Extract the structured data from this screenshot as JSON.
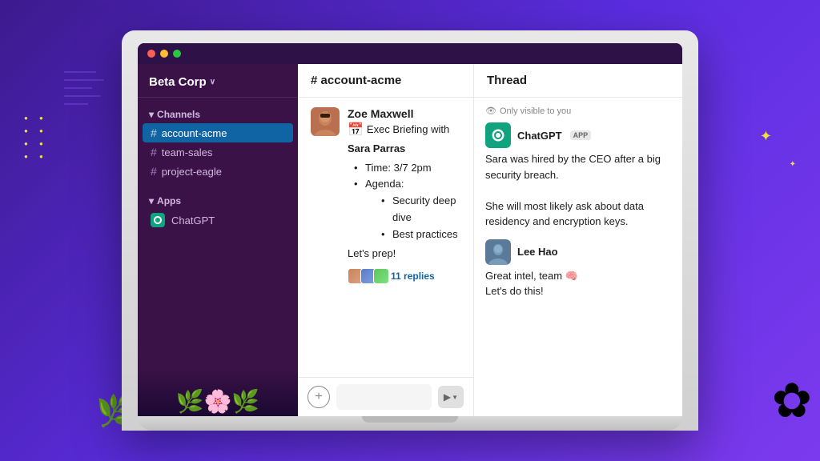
{
  "background": {
    "gradient_start": "#3d1a8e",
    "gradient_end": "#7c3aed"
  },
  "window": {
    "title_bar": {
      "btn_red": "close",
      "btn_yellow": "minimize",
      "btn_green": "maximize"
    }
  },
  "sidebar": {
    "workspace_name": "Beta Corp",
    "workspace_chevron": "∨",
    "sections": {
      "channels_label": "Channels",
      "apps_label": "Apps"
    },
    "channels": [
      {
        "name": "account-acme",
        "active": true
      },
      {
        "name": "team-sales",
        "active": false
      },
      {
        "name": "project-eagle",
        "active": false
      }
    ],
    "apps": [
      {
        "name": "ChatGPT"
      }
    ]
  },
  "channel": {
    "header": "# account-acme",
    "message": {
      "sender": "Zoe Maxwell",
      "calendar_icon": "📅",
      "title_line": "Exec Briefing with",
      "title_line2": "Sara Parras",
      "bullet1": "Time: 3/7 2pm",
      "bullet2": "Agenda:",
      "subbullet1": "Security deep dive",
      "subbullet2": "Best practices",
      "closing": "Let's prep!",
      "replies_count": "11 replies"
    },
    "input": {
      "plus_icon": "+",
      "send_icon": "▶"
    }
  },
  "thread": {
    "header": "Thread",
    "visibility_note": "Only visible to you",
    "messages": [
      {
        "sender": "ChatGPT",
        "badge": "APP",
        "text_lines": [
          "Sara was hired by",
          "the CEO after a big",
          "security breach.",
          "",
          "She will most likely",
          "ask about data",
          "residency and",
          "encryption keys."
        ]
      },
      {
        "sender": "Lee Hao",
        "text_lines": [
          "Great intel, team 🧠",
          "Let's do this!"
        ]
      }
    ]
  }
}
